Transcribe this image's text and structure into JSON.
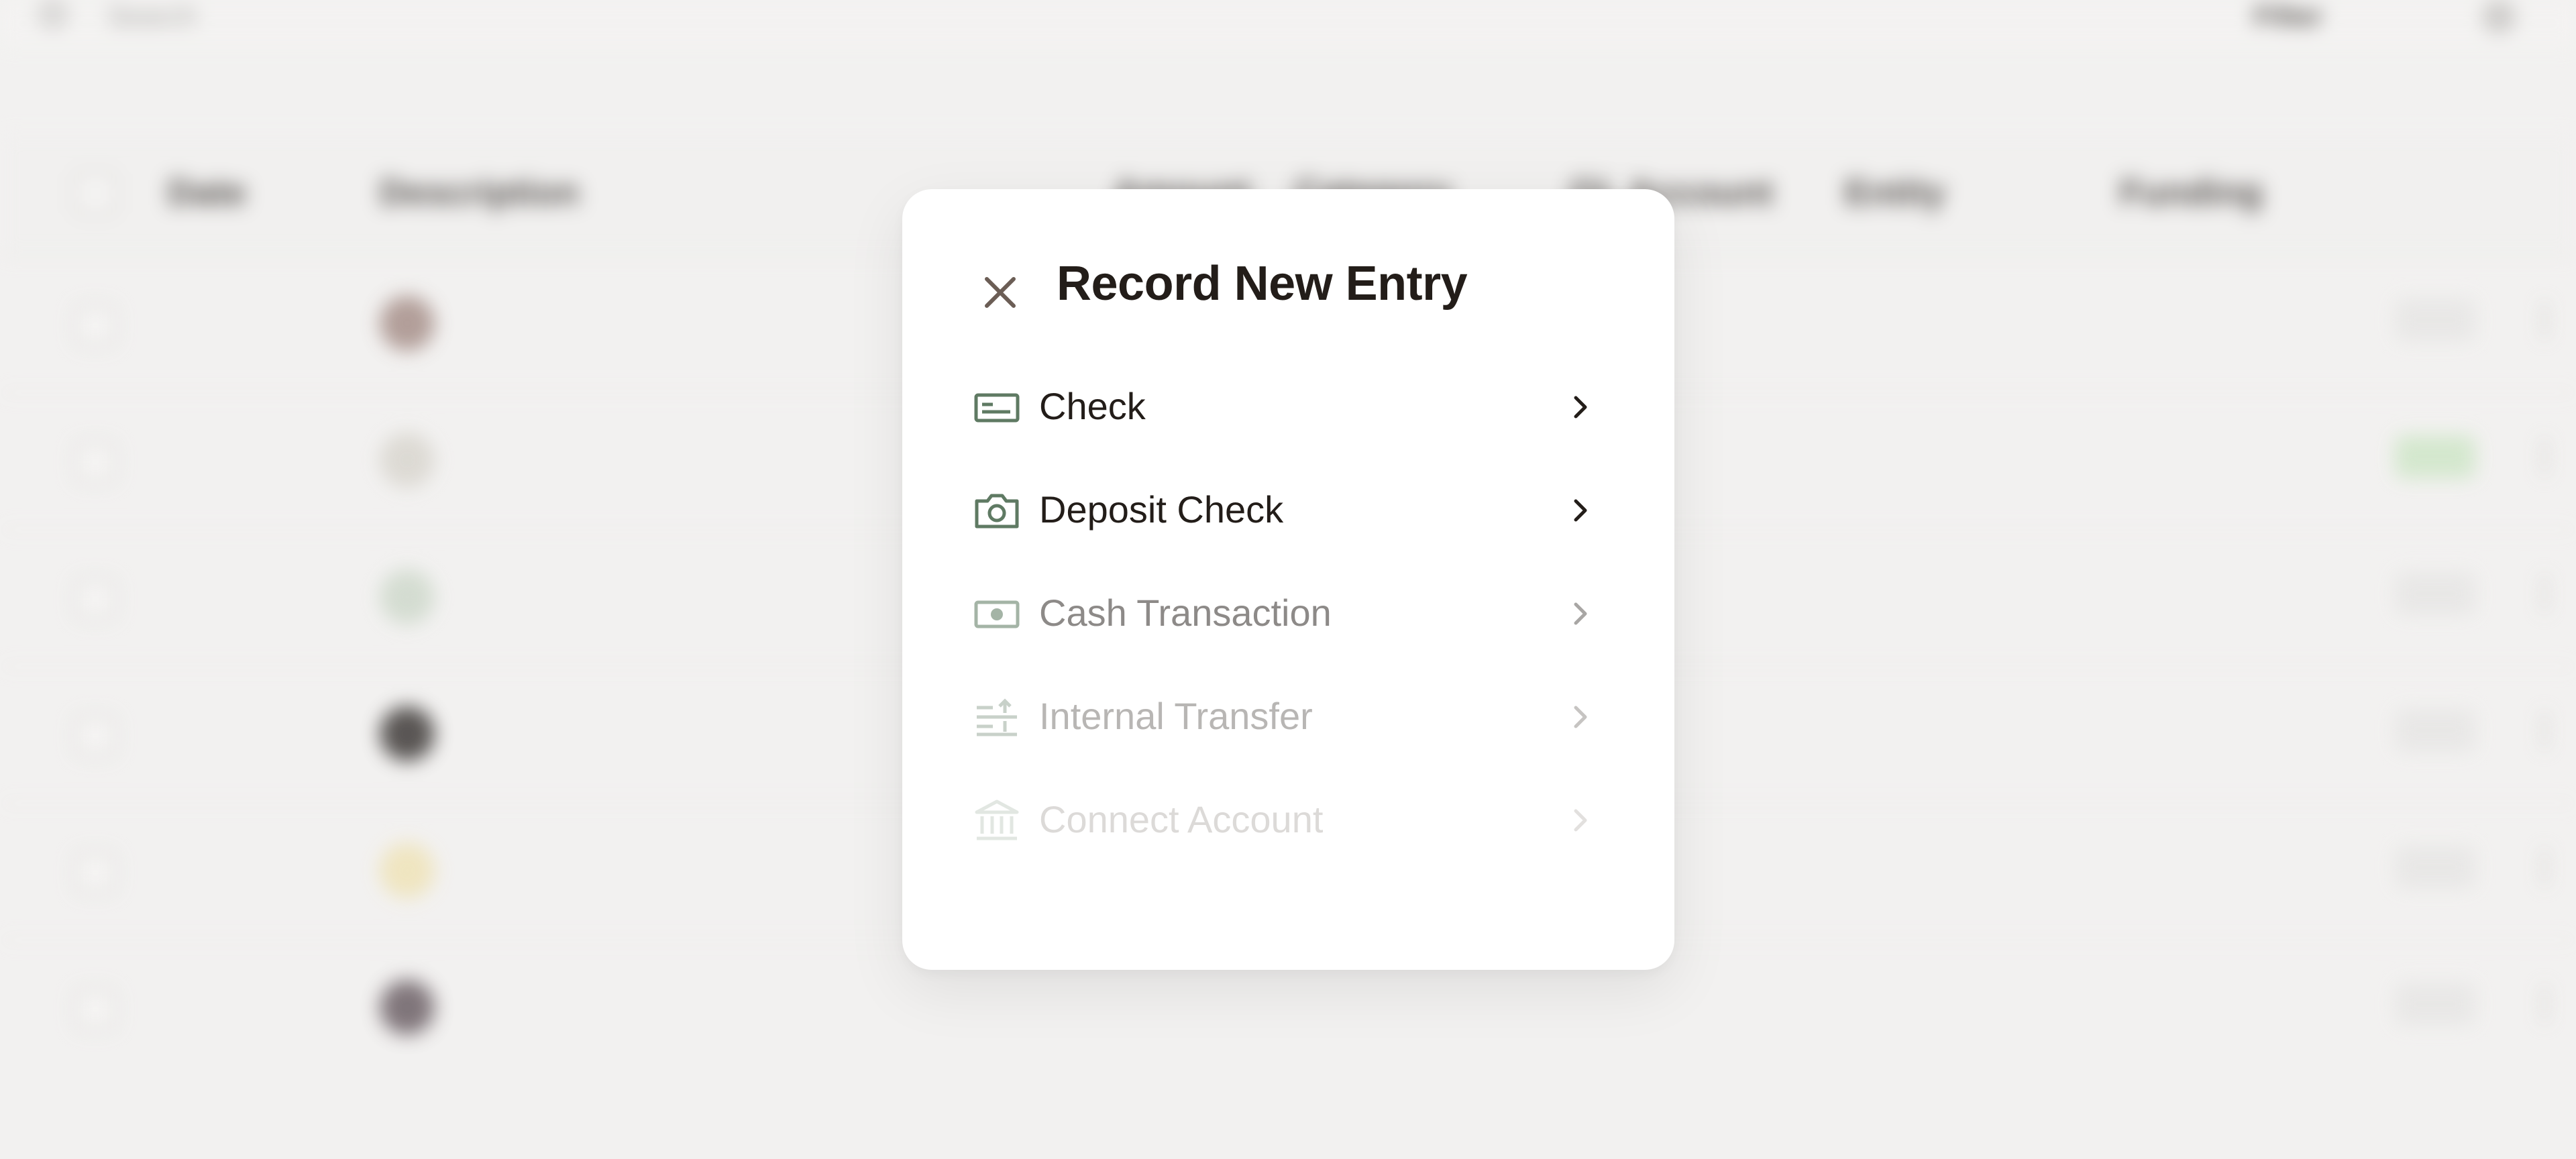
{
  "background": {
    "search_placeholder": "Search",
    "filter_label": "Filter",
    "columns": [
      "Date",
      "Description",
      "Amount",
      "Category",
      "GL Account",
      "Entity",
      "Funding"
    ]
  },
  "modal": {
    "title": "Record New Entry",
    "items": [
      {
        "label": "Check",
        "icon": "check-icon",
        "color": "#231d19",
        "icon_color": "#5f7a63",
        "chevron_color": "#231d19"
      },
      {
        "label": "Deposit Check",
        "icon": "camera-icon",
        "color": "#231d19",
        "icon_color": "#5f7a63",
        "chevron_color": "#231d19"
      },
      {
        "label": "Cash Transaction",
        "icon": "cash-icon",
        "color": "#8d8a88",
        "icon_color": "#a4b4a6",
        "chevron_color": "#a8a6a4"
      },
      {
        "label": "Internal Transfer",
        "icon": "transfer-icon",
        "color": "#b8b6b4",
        "icon_color": "#c8d1c9",
        "chevron_color": "#c6c4c2"
      },
      {
        "label": "Connect Account",
        "icon": "bank-icon",
        "color": "#dcdad8",
        "icon_color": "#e2e7e2",
        "chevron_color": "#e2e0de"
      }
    ]
  },
  "colors": {
    "accent_green": "#5f7a63",
    "modal_bg": "#ffffff",
    "backdrop": "#f2f1f0"
  }
}
